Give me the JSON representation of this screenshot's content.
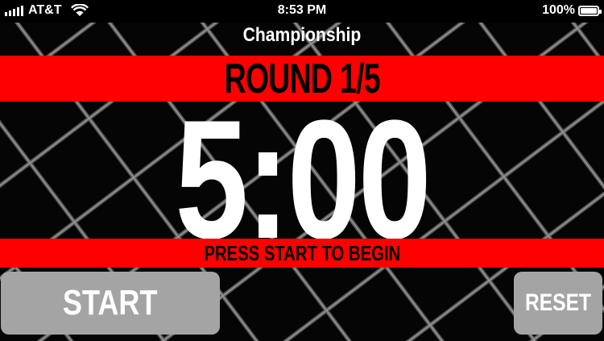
{
  "status_bar": {
    "carrier": "AT&T",
    "time": "8:53 PM",
    "battery": "100%"
  },
  "event": {
    "title": "Championship"
  },
  "round": {
    "label": "ROUND 1/5",
    "current": 1,
    "total": 5
  },
  "timer": {
    "display": "5:00"
  },
  "status_message": "PRESS START TO BEGIN",
  "buttons": {
    "start_label": "START",
    "reset_label": "RESET"
  },
  "colors": {
    "band": "#ff0000",
    "button": "#a4a4a4",
    "background": "#000000",
    "text": "#ffffff"
  }
}
